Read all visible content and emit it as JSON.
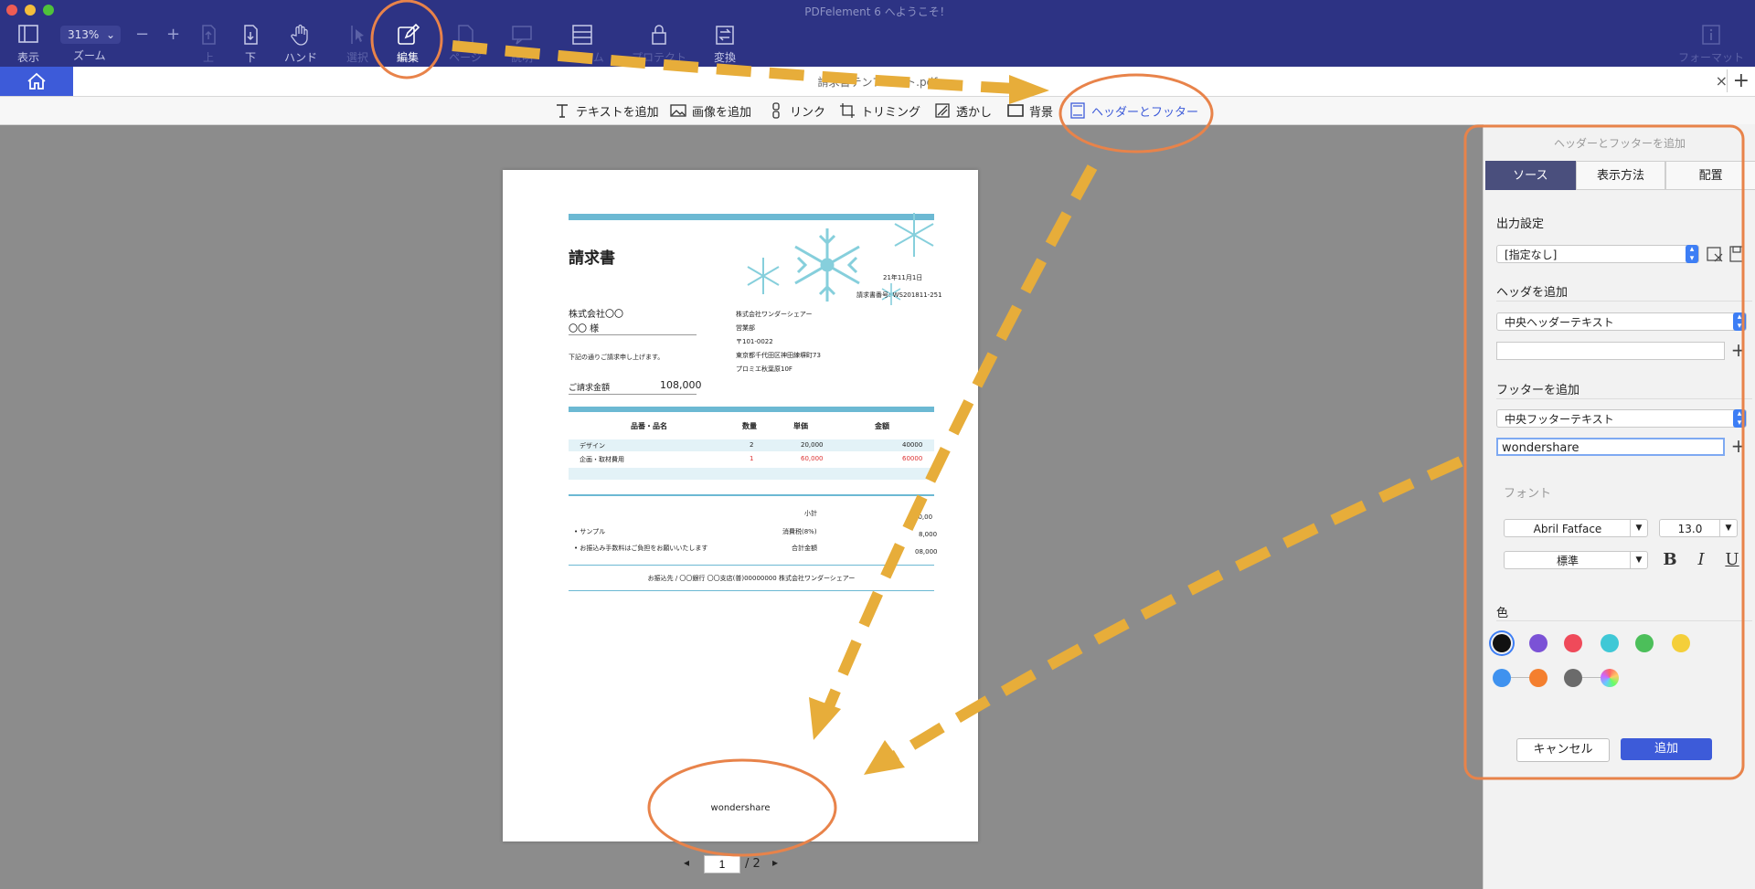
{
  "window": {
    "title": "PDFelement 6 へようこそ！"
  },
  "toolbar": {
    "view_label": "表示",
    "zoom_value": "313%",
    "zoom_label": "ズーム",
    "zoom_minus": "−",
    "zoom_plus": "+",
    "up_label": "上",
    "down_label": "下",
    "hand_label": "ハンド",
    "select_label": "選択",
    "edit_label": "編集",
    "page_label": "ページ",
    "comment_label": "説明",
    "form_label": "フォーム",
    "protect_label": "プロテクト",
    "convert_label": "変換",
    "format_label": "フォーマット"
  },
  "tabbar": {
    "document_title": "請求書テンプレート.pdf",
    "close": "×",
    "add": "+"
  },
  "editbar": {
    "items": [
      {
        "label": "テキストを追加",
        "icon": "text-icon"
      },
      {
        "label": "画像を追加",
        "icon": "image-icon"
      },
      {
        "label": "リンク",
        "icon": "link-icon"
      },
      {
        "label": "トリミング",
        "icon": "crop-icon"
      },
      {
        "label": "透かし",
        "icon": "watermark-icon"
      },
      {
        "label": "背景",
        "icon": "background-icon"
      },
      {
        "label": "ヘッダーとフッター",
        "icon": "header-footer-icon",
        "active": true
      }
    ]
  },
  "document": {
    "title": "請求書",
    "date": "21年11月1日",
    "invoice_no": "請求書番号: WS201811-251",
    "client_company": "株式会社〇〇",
    "client_name": "〇〇 様",
    "issuer_company": "株式会社ワンダーシェアー",
    "issuer_dept": "営業部",
    "issuer_zip": "〒101-0022",
    "issuer_address": "東京都千代田区神田練塀町73",
    "issuer_building": "プロミエ秋葉原10F",
    "request_text": "下記の通りご請求申し上げます。",
    "amount_label": "ご請求金額",
    "amount_value": "108,000",
    "table_headers": [
      "品番・品名",
      "数量",
      "単価",
      "金額"
    ],
    "table_rows": [
      [
        "デザイン",
        "2",
        "20,000",
        "40000"
      ],
      [
        "企画・取材費用",
        "1",
        "60,000",
        "60000"
      ]
    ],
    "subtotal_label": "小計",
    "subtotal_value": "00,00",
    "tax_label": "消費税(8%)",
    "tax_value": "8,000",
    "total_label": "合計金額",
    "total_value": "08,000",
    "note1": "サンプル",
    "note2": "お振込み手数料はご負担をお願いいたします",
    "bank_info": "お振込先 / 〇〇銀行 〇〇支店(普)00000000 株式会社ワンダーシェアー",
    "footer_text": "wondershare"
  },
  "pager": {
    "current": "1",
    "total": "/ 2"
  },
  "panel": {
    "title": "ヘッダーとフッターを追加",
    "tabs": [
      "ソース",
      "表示方法",
      "配置"
    ],
    "output_settings_label": "出力設定",
    "output_settings_value": "[指定なし]",
    "header_section_label": "ヘッダを追加",
    "header_position_value": "中央ヘッダーテキスト",
    "header_text_value": "",
    "footer_section_label": "フッターを追加",
    "footer_position_value": "中央フッターテキスト",
    "footer_text_value": "wondershare",
    "font_label": "フォント",
    "font_family_value": "Abril Fatface",
    "font_size_value": "13.0",
    "font_style_value": "標準",
    "bold_label": "B",
    "italic_label": "I",
    "underline_label": "U",
    "color_label": "色",
    "colors": [
      "#111111",
      "#7b52d6",
      "#ef4a5a",
      "#3fc8d6",
      "#4cbf5a",
      "#f4cf3a",
      "#3f92ef",
      "#f47f2e",
      "#6b6b6b",
      "rainbow"
    ],
    "cancel_label": "キャンセル",
    "add_label": "追加"
  }
}
